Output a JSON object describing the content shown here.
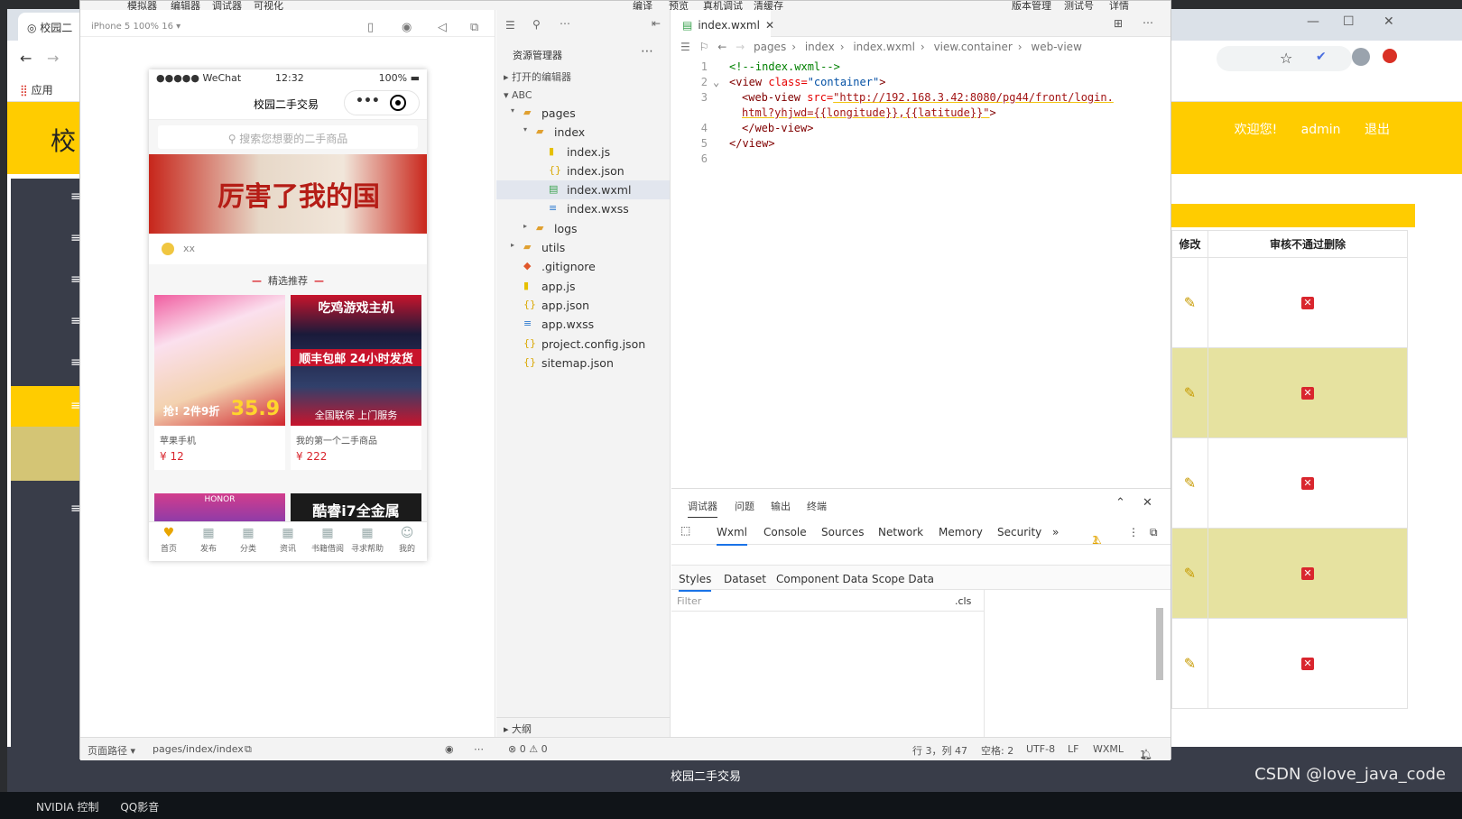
{
  "browser": {
    "tab_title": "校园二",
    "bookmarks_label": "应用",
    "header_title": "校",
    "header_links": [
      "欢迎您!",
      "admin",
      "退出"
    ],
    "table_headers": [
      "修改",
      "审核不通过删除"
    ],
    "row_count": 5,
    "footer_text": "校园二手交易"
  },
  "taskbar": {
    "items": [
      "NVIDIA 控制",
      "QQ影音"
    ]
  },
  "watermark": "CSDN @love_java_code",
  "ide": {
    "menu": [
      "模拟器",
      "编辑器",
      "调试器",
      "可视化",
      "编译",
      "预览",
      "真机调试",
      "清缓存",
      "版本管理",
      "测试号",
      "详情"
    ],
    "device_label": "iPhone 5 100% 16 ▾",
    "phone": {
      "carrier": "●●●●● WeChat",
      "time": "12:32",
      "battery": "100%",
      "nav_title": "校园二手交易",
      "search_placeholder": "搜索您想要的二手商品",
      "banner_text": "厉害了我的国",
      "notice_text": "xx",
      "section_title": "精选推荐",
      "products": [
        {
          "name": "苹果手机",
          "price": "¥ 12",
          "img_text": "抢! 2件9折",
          "img_price": "35.9"
        },
        {
          "name": "我的第一个二手商品",
          "price": "¥ 222",
          "img_title": "吃鸡游戏主机",
          "img_mid": "顺丰包邮 24小时发货",
          "img_bottom": "全国联保 上门服务"
        }
      ],
      "next_a": "HONOR",
      "next_b": "酷睿i7全金属",
      "tabs": [
        "首页",
        "发布",
        "分类",
        "资讯",
        "书籍借阅",
        "寻求帮助",
        "我的"
      ]
    },
    "explorer": {
      "title": "资源管理器",
      "open_editors": "打开的编辑器",
      "project": "ABC",
      "tree": [
        {
          "label": "pages",
          "indent": 1,
          "kind": "folder-open"
        },
        {
          "label": "index",
          "indent": 2,
          "kind": "folder-open"
        },
        {
          "label": "index.js",
          "indent": 3,
          "kind": "js"
        },
        {
          "label": "index.json",
          "indent": 3,
          "kind": "json"
        },
        {
          "label": "index.wxml",
          "indent": 3,
          "kind": "wxml",
          "selected": true
        },
        {
          "label": "index.wxss",
          "indent": 3,
          "kind": "wxss"
        },
        {
          "label": "logs",
          "indent": 2,
          "kind": "folder"
        },
        {
          "label": "utils",
          "indent": 1,
          "kind": "folder"
        },
        {
          "label": ".gitignore",
          "indent": 1,
          "kind": "git"
        },
        {
          "label": "app.js",
          "indent": 1,
          "kind": "js"
        },
        {
          "label": "app.json",
          "indent": 1,
          "kind": "json"
        },
        {
          "label": "app.wxss",
          "indent": 1,
          "kind": "wxss"
        },
        {
          "label": "project.config.json",
          "indent": 1,
          "kind": "json"
        },
        {
          "label": "sitemap.json",
          "indent": 1,
          "kind": "json"
        }
      ],
      "outline": "大纲"
    },
    "editor": {
      "tab": "index.wxml",
      "breadcrumb": [
        "pages",
        "index",
        "index.wxml",
        "view.container",
        "web-view"
      ],
      "lines": [
        "1",
        "2",
        "3",
        "",
        "4",
        "5",
        "6"
      ],
      "code": {
        "l1": "<!--index.wxml-->",
        "l2_tag": "<view",
        "l2_attr": " class=",
        "l2_val": "\"container\"",
        "l2_end": ">",
        "l3_tag": "<web-view",
        "l3_attr": " src=",
        "l3_val": "\"http://192.168.3.42:8080/pg44/front/login.",
        "l3b_val": "html?yhjwd={{longitude}},{{latitude}}\"",
        "l3b_end": ">",
        "l4": "</web-view>",
        "l5": "</view>"
      }
    },
    "devtools": {
      "top_tabs": [
        "调试器",
        "问题",
        "输出",
        "终端"
      ],
      "tabs": [
        "Wxml",
        "Console",
        "Sources",
        "Network",
        "Memory",
        "Security"
      ],
      "warn_count": "1",
      "sub_tabs": [
        "Styles",
        "Dataset",
        "Component Data",
        "Scope Data"
      ],
      "filter_placeholder": "Filter",
      "cls": ".cls"
    },
    "status": {
      "page_path_label": "页面路径 ▾",
      "page_path": "pages/index/index",
      "errors": "⊗ 0 ⚠ 0",
      "position": "行 3，列 47",
      "spaces": "空格: 2",
      "encoding": "UTF-8",
      "eol": "LF",
      "lang": "WXML",
      "notifications": "1"
    }
  }
}
